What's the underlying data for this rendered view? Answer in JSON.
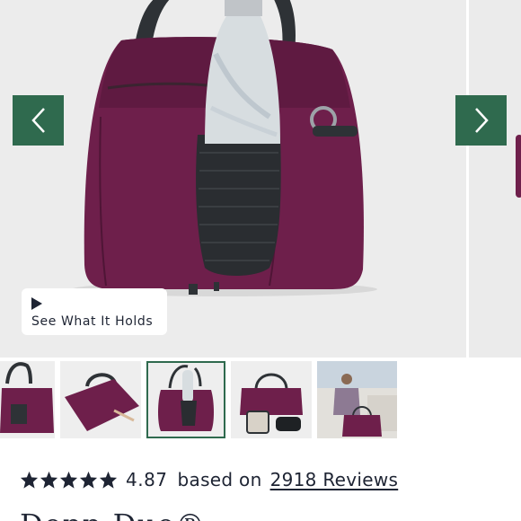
{
  "gallery": {
    "prev_label": "Previous image",
    "next_label": "Next image",
    "video_cta": {
      "label": "See What It Holds",
      "icon": "play-icon"
    },
    "colors": {
      "nav_button": "#2f6a4e",
      "bag": "#6e1f4b",
      "background": "#ececec"
    }
  },
  "thumbnails": {
    "count": 5,
    "active_index": 2,
    "active_border": "#2f6a4e"
  },
  "rating": {
    "stars": 5,
    "star_icon": "star-icon",
    "value": "4.87",
    "based_on": "based on",
    "reviews_label": "2918 Reviews"
  },
  "product": {
    "title_partial": "Dopp Duo®"
  }
}
